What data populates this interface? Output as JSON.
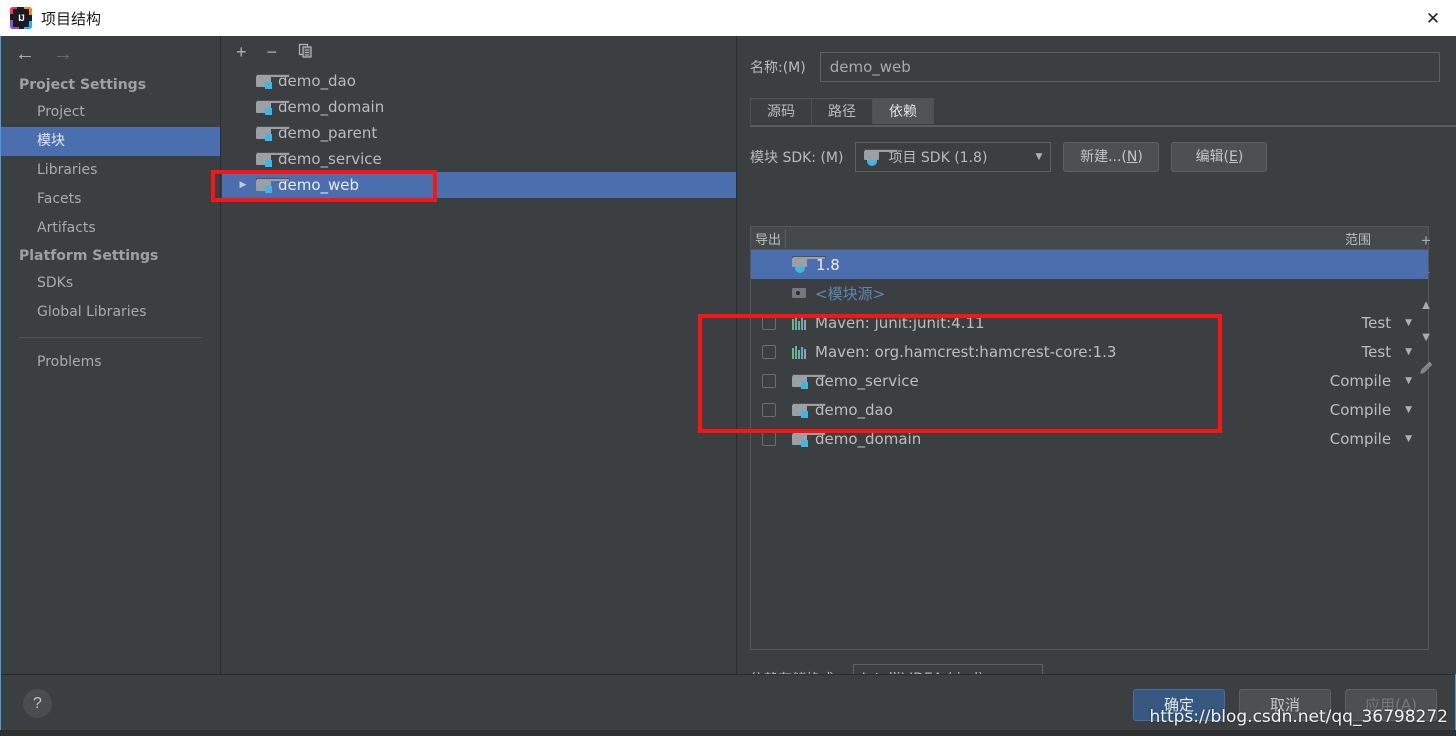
{
  "window": {
    "title": "项目结构",
    "logo_icon": "intellij-idea-logo",
    "close_icon": "✕"
  },
  "sidebar": {
    "back_icon": "←",
    "forward_icon": "→",
    "groups": [
      {
        "title": "Project Settings",
        "items": [
          {
            "label": "Project",
            "selected": false
          },
          {
            "label": "模块",
            "selected": true
          },
          {
            "label": "Libraries",
            "selected": false
          },
          {
            "label": "Facets",
            "selected": false
          },
          {
            "label": "Artifacts",
            "selected": false
          }
        ]
      },
      {
        "title": "Platform Settings",
        "items": [
          {
            "label": "SDKs",
            "selected": false
          },
          {
            "label": "Global Libraries",
            "selected": false
          }
        ]
      }
    ],
    "extra_items": [
      {
        "label": "Problems",
        "selected": false
      }
    ]
  },
  "modules_panel": {
    "toolbar": {
      "add_icon": "+",
      "remove_icon": "−",
      "copy_icon": "copy-icon"
    },
    "items": [
      {
        "label": "demo_dao",
        "selected": false,
        "expandable": false
      },
      {
        "label": "demo_domain",
        "selected": false,
        "expandable": false
      },
      {
        "label": "demo_parent",
        "selected": false,
        "expandable": false
      },
      {
        "label": "demo_service",
        "selected": false,
        "expandable": false
      },
      {
        "label": "demo_web",
        "selected": true,
        "expandable": true
      }
    ]
  },
  "detail": {
    "name_label": "名称:(M)",
    "name_value": "demo_web",
    "tabs": [
      {
        "label": "源码",
        "active": false
      },
      {
        "label": "路径",
        "active": false
      },
      {
        "label": "依赖",
        "active": true
      }
    ],
    "sdk": {
      "label": "模块 SDK: (M)",
      "value": "项目 SDK (1.8)",
      "new_button": "新建...(N)",
      "new_button_mnemonic": "N",
      "edit_button": "编辑(E)",
      "edit_button_mnemonic": "E"
    },
    "table": {
      "columns": {
        "export": "导出",
        "scope": "范围"
      },
      "rows": [
        {
          "name": "1.8",
          "icon": "jdk-icon",
          "scope": "",
          "checkbox": false,
          "has_checkbox": false,
          "selected": true,
          "link": false
        },
        {
          "name": "<模块源>",
          "icon": "source-root-icon",
          "scope": "",
          "checkbox": false,
          "has_checkbox": false,
          "selected": false,
          "link": true
        },
        {
          "name": "Maven: junit:junit:4.11",
          "icon": "maven-library-icon",
          "scope": "Test",
          "checkbox": false,
          "has_checkbox": true,
          "selected": false,
          "link": false
        },
        {
          "name": "Maven: org.hamcrest:hamcrest-core:1.3",
          "icon": "maven-library-icon",
          "scope": "Test",
          "checkbox": false,
          "has_checkbox": true,
          "selected": false,
          "link": false
        },
        {
          "name": "demo_service",
          "icon": "module-icon",
          "scope": "Compile",
          "checkbox": false,
          "has_checkbox": true,
          "selected": false,
          "link": false
        },
        {
          "name": "demo_dao",
          "icon": "module-icon",
          "scope": "Compile",
          "checkbox": false,
          "has_checkbox": true,
          "selected": false,
          "link": false
        },
        {
          "name": "demo_domain",
          "icon": "module-icon",
          "scope": "Compile",
          "checkbox": false,
          "has_checkbox": true,
          "selected": false,
          "link": false
        }
      ],
      "side_toolbar": {
        "add_icon": "+",
        "remove_icon": "−",
        "move_up_icon": "▲",
        "move_down_icon": "▼",
        "edit_icon": "pencil-icon"
      }
    },
    "storage": {
      "label": "依赖存储格式:",
      "value": "IntelliJ IDEA (.iml)"
    }
  },
  "footer": {
    "help_icon": "?",
    "ok_button": "确定",
    "cancel_button": "取消",
    "apply_button": "应用(A)",
    "apply_mnemonic": "A"
  },
  "watermark": {
    "text": "https://blog.csdn.net/qq_36798272"
  },
  "colors": {
    "selection_blue": "#4b6eaf",
    "primary_button": "#365880",
    "annotation_red": "#fb1414",
    "panel_bg": "#3c3f41",
    "link_blue": "#5c86b5"
  }
}
